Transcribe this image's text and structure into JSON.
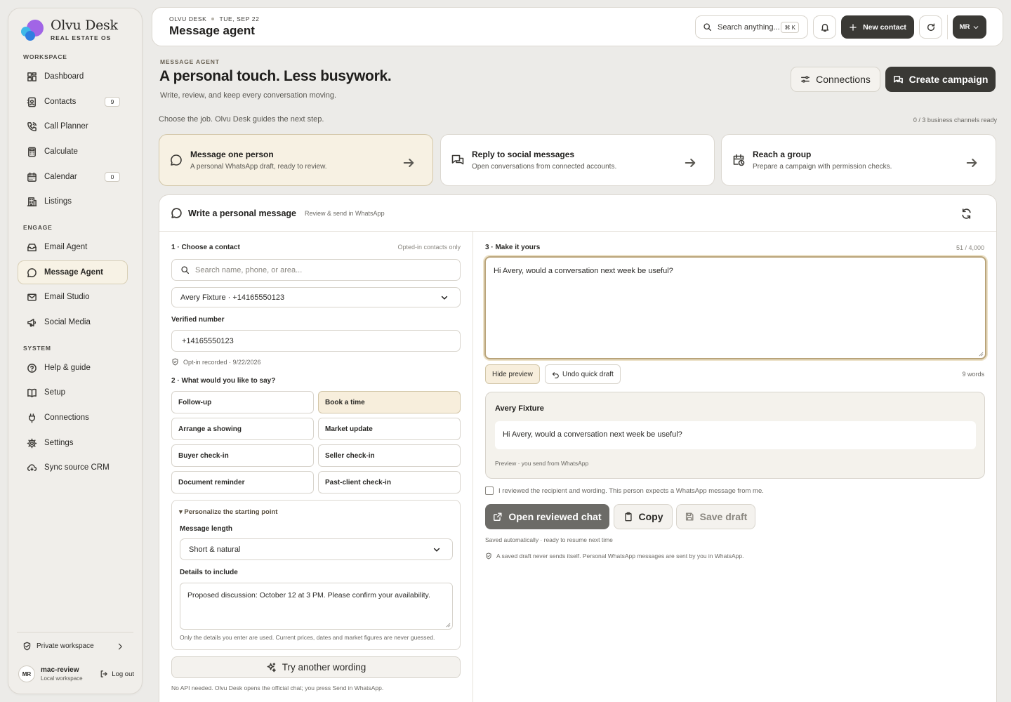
{
  "app": {
    "brand": "Olvu Desk",
    "brand_sub": "REAL ESTATE OS"
  },
  "sidebar": {
    "sections": [
      "WORKSPACE",
      "ENGAGE",
      "SYSTEM"
    ],
    "items": [
      {
        "label": "Dashboard",
        "icon": "dashboard-icon",
        "badge": ""
      },
      {
        "label": "Contacts",
        "icon": "contacts-icon",
        "badge": "9"
      },
      {
        "label": "Call Planner",
        "icon": "phone-icon",
        "badge": ""
      },
      {
        "label": "Calculate",
        "icon": "calculator-icon",
        "badge": ""
      },
      {
        "label": "Calendar",
        "icon": "calendar-icon",
        "badge": "0"
      },
      {
        "label": "Listings",
        "icon": "building-icon",
        "badge": ""
      },
      {
        "label": "Email Agent",
        "icon": "inbox-icon",
        "badge": ""
      },
      {
        "label": "Message Agent",
        "icon": "chat-icon",
        "badge": "",
        "active": true
      },
      {
        "label": "Email Studio",
        "icon": "mail-icon",
        "badge": ""
      },
      {
        "label": "Social Media",
        "icon": "megaphone-icon",
        "badge": ""
      },
      {
        "label": "Help & guide",
        "icon": "help-icon",
        "badge": ""
      },
      {
        "label": "Setup",
        "icon": "book-icon",
        "badge": ""
      },
      {
        "label": "Connections",
        "icon": "plug-icon",
        "badge": ""
      },
      {
        "label": "Settings",
        "icon": "gear-icon",
        "badge": ""
      },
      {
        "label": "Sync source CRM",
        "icon": "cloud-sync-icon",
        "badge": ""
      }
    ],
    "private_workspace": "Private workspace",
    "user": {
      "initials": "MR",
      "name": "mac-review",
      "sub": "Local workspace",
      "logout": "Log out"
    }
  },
  "topbar": {
    "crumb_app": "OLVU DESK",
    "crumb_date": "TUE, SEP 22",
    "title": "Message agent",
    "search_placeholder": "Search anything...",
    "search_kbd": "⌘ K",
    "new_contact": "New contact",
    "avatar": "MR"
  },
  "hero": {
    "eyebrow": "MESSAGE AGENT",
    "title": "A personal touch. Less busywork.",
    "subtitle": "Write, review, and keep every conversation moving.",
    "connections_btn": "Connections",
    "create_campaign_btn": "Create campaign",
    "guide": "Choose the job. Olvu Desk guides the next step.",
    "channels_ready": "0 / 3 business channels ready"
  },
  "jobs": [
    {
      "title": "Message one person",
      "sub": "A personal WhatsApp draft, ready to review.",
      "icon": "chat-bubble-icon",
      "selected": true
    },
    {
      "title": "Reply to social messages",
      "sub": "Open conversations from connected accounts.",
      "icon": "chat-bubbles-icon",
      "selected": false
    },
    {
      "title": "Reach a group",
      "sub": "Prepare a campaign with permission checks.",
      "icon": "calendar-clock-icon",
      "selected": false
    }
  ],
  "composer": {
    "title": "Write a personal message",
    "sub": "Review & send in WhatsApp",
    "step1": "1 · Choose a contact",
    "step1_hint": "Opted-in contacts only",
    "contact_search_placeholder": "Search name, phone, or area...",
    "contact_selected": "Avery Fixture · +14165550123",
    "verified_label": "Verified number",
    "verified_value": "+14165550123",
    "optin": "Opt-in recorded · 9/22/2026",
    "step2": "2 · What would you like to say?",
    "tones": [
      {
        "label": "Follow-up",
        "selected": false
      },
      {
        "label": "Book a time",
        "selected": true
      },
      {
        "label": "Arrange a showing",
        "selected": false
      },
      {
        "label": "Market update",
        "selected": false
      },
      {
        "label": "Buyer check-in",
        "selected": false
      },
      {
        "label": "Seller check-in",
        "selected": false
      },
      {
        "label": "Document reminder",
        "selected": false
      },
      {
        "label": "Past-client check-in",
        "selected": false
      }
    ],
    "personalize_title": "▾ Personalize the starting point",
    "length_label": "Message length",
    "length_value": "Short & natural",
    "details_label": "Details to include",
    "details_value": "Proposed discussion: October 12 at 3 PM. Please confirm your availability.",
    "details_hint": "Only the details you enter are used. Current prices, dates and market figures are never guessed.",
    "try_btn": "Try another wording",
    "api_note": "No API needed. Olvu Desk opens the official chat; you press Send in WhatsApp.",
    "step3": "3 · Make it yours",
    "char_count": "51 / 4,000",
    "message": "Hi Avery, would a conversation next week be useful?",
    "hide_preview": "Hide preview",
    "undo": "Undo quick draft",
    "word_count": "9 words",
    "preview_name": "Avery Fixture",
    "preview_text": "Hi Avery, would a conversation next week be useful?",
    "preview_foot": "Preview · you send from WhatsApp",
    "confirm": "I reviewed the recipient and wording. This person expects a WhatsApp message from me.",
    "open_chat": "Open reviewed chat",
    "copy": "Copy",
    "save_draft": "Save draft",
    "saved_note": "Saved automatically · ready to resume next time",
    "safety_note": "A saved draft never sends itself. Personal WhatsApp messages are sent by you in WhatsApp."
  },
  "colors": {
    "accent_dark": "#3a3935",
    "selected_bg": "#f7f1e3",
    "focus_border": "#b9a47a"
  }
}
